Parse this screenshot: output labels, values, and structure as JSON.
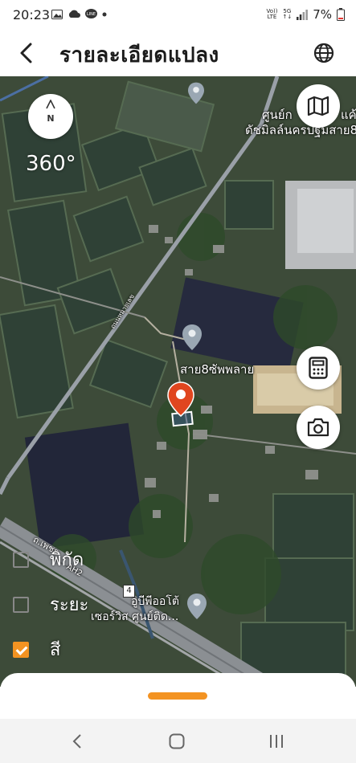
{
  "status": {
    "time": "20:23",
    "battery": "7%",
    "net_top": "Vo))",
    "net_bottom": "LTE",
    "sig_top": "5G",
    "sig_bottom": "↑↓"
  },
  "header": {
    "title": "รายละเอียดแปลง"
  },
  "map": {
    "compass_label": "N",
    "rotation": "360°",
    "labels": {
      "top_right_1": "ศูนย์ก",
      "top_right_1b": "แค้",
      "top_right_2": "ดัชมิลล์นครปฐมสาย8",
      "place_marker": "สาย8ซัพพลาย",
      "road": "ถนนหมายเลข",
      "highway_1": "ถ.เพชร",
      "highway_2": "AH2",
      "route_number": "4",
      "bottom_poi_1": "อูบีพีออโต้",
      "bottom_poi_2": "เซอร์วิส ศูนย์ติด..."
    }
  },
  "layers": [
    {
      "label": "พิกัด",
      "checked": false
    },
    {
      "label": "ระยะ",
      "checked": false
    },
    {
      "label": "สี",
      "checked": true
    }
  ],
  "colors": {
    "accent": "#f39322",
    "pin": "#e0461f"
  },
  "icons": [
    "back-arrow-icon",
    "globe-icon",
    "map-icon",
    "calculator-icon",
    "camera-icon"
  ]
}
